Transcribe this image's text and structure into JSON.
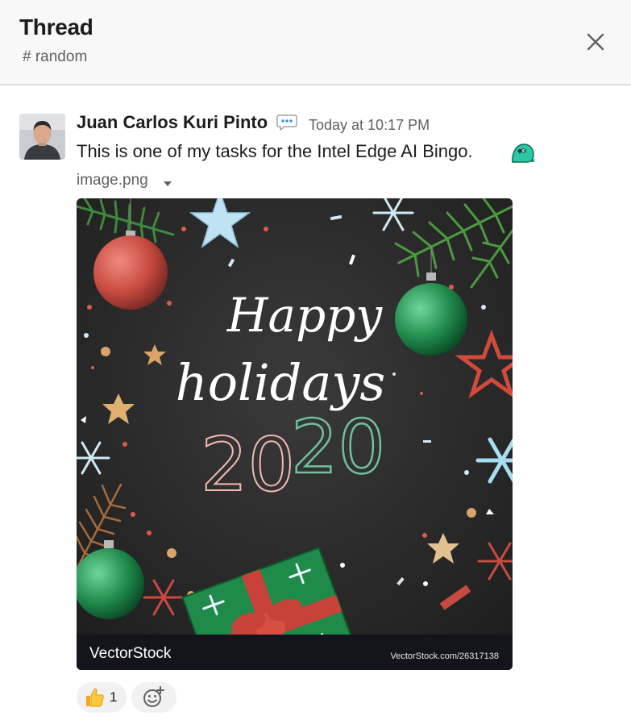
{
  "header": {
    "title": "Thread",
    "channel": "# random"
  },
  "message": {
    "author": "Juan Carlos Kuri Pinto",
    "timestamp": "Today at 10:17 PM",
    "text": "This is one of my tasks for the Intel Edge AI Bingo.",
    "status_emoji": "speech-balloon-icon",
    "inline_emoji": "parrot-icon"
  },
  "attachment": {
    "file_name": "image.png",
    "image": {
      "line1": "Happy",
      "line2": "holidays",
      "year_part1": "20",
      "year_part2": "20",
      "watermark_brand": "VectorStock",
      "watermark_id": "VectorStock.com/26317138"
    }
  },
  "reactions": [
    {
      "icon": "thumbs-up-icon",
      "count": "1"
    }
  ],
  "colors": {
    "text": "#1d1c1d",
    "muted": "#616061",
    "header_bg": "#f8f8f8",
    "reaction_bg": "#f1f1f1",
    "image_bg": "#2a2a2a",
    "pink": "#f2b8b0",
    "green": "#6fc09a"
  }
}
